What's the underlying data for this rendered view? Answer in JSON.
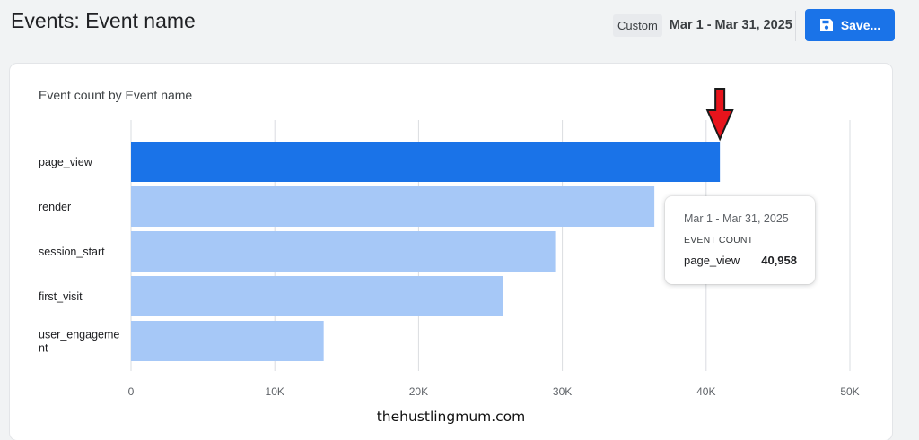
{
  "header": {
    "title": "Events: Event name",
    "date_chip": "Custom",
    "date_range": "Mar 1 - Mar 31, 2025",
    "save_label": "Save...",
    "save_icon": "floppy-disk-icon"
  },
  "card": {
    "title": "Event count by Event name"
  },
  "chart_data": {
    "type": "bar",
    "orientation": "horizontal",
    "title": "Event count by Event name",
    "categories": [
      "page_view",
      "render",
      "session_start",
      "first_visit",
      "user_engagement"
    ],
    "category_labels": [
      [
        "page_view"
      ],
      [
        "render"
      ],
      [
        "session_start"
      ],
      [
        "first_visit"
      ],
      [
        "user_engageme",
        "nt"
      ]
    ],
    "values": [
      40958,
      36400,
      29500,
      25900,
      13400
    ],
    "highlighted_index": 0,
    "xlim": [
      0,
      50000
    ],
    "x_ticks": [
      0,
      10000,
      20000,
      30000,
      40000,
      50000
    ],
    "x_tick_labels": [
      "0",
      "10K",
      "20K",
      "30K",
      "40K",
      "50K"
    ],
    "grid": true,
    "colors": {
      "highlight": "#1a73e8",
      "bar": "#a6c8f7",
      "grid": "#dadce0"
    }
  },
  "tooltip": {
    "date": "Mar 1 - Mar 31, 2025",
    "metric": "EVENT COUNT",
    "name": "page_view",
    "value": "40,958"
  },
  "annotation": {
    "arrow_icon": "red-down-arrow-icon",
    "arrow_color": "#e8141c"
  },
  "watermark": "thehustlingmum.com"
}
